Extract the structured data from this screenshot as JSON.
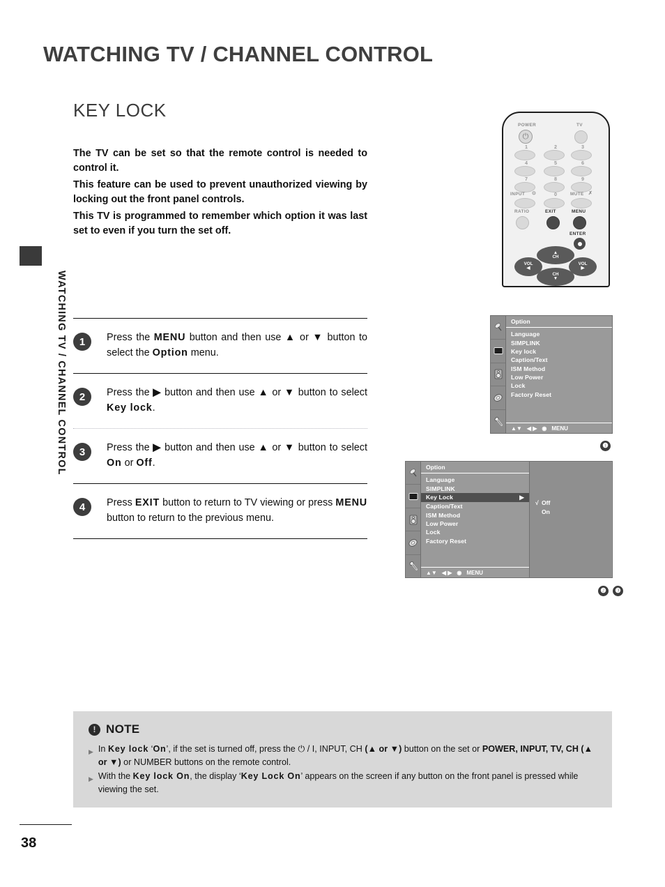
{
  "chapter": {
    "title": "WATCHING TV / CHANNEL CONTROL",
    "vertical_tab": "WATCHING TV / CHANNEL CONTROL"
  },
  "section": {
    "title": "KEY LOCK"
  },
  "intro": {
    "p1": "The TV can be set so that the remote control is needed to control it.",
    "p2": "This feature can be used to prevent unauthorized viewing by locking out the front panel controls.",
    "p3": "This TV is programmed to remember which option it was last set to even if you turn the set off."
  },
  "steps": [
    {
      "number": "1",
      "line1_a": "Press the ",
      "line1_b": "MENU",
      "line1_c": " button and then use ",
      "line1_d": "▲",
      "line1_e": " or ",
      "line1_f": "▼",
      "line1_g": " button to select the ",
      "line1_h": "Option",
      "line1_i": " menu."
    },
    {
      "number": "2",
      "line1_a": "Press the ",
      "line1_b": "▶",
      "line1_c": " button and then use ",
      "line1_d": "▲",
      "line1_e": " or ",
      "line1_f": "▼",
      "line1_g": " button to select ",
      "line1_h": "Key lock",
      "line1_i": "."
    },
    {
      "number": "3",
      "line1_a": "Press the ",
      "line1_b": "▶",
      "line1_c": " button and then use ",
      "line1_d": "▲",
      "line1_e": " or ",
      "line1_f": "▼",
      "line1_g": " button to select ",
      "line1_h": "On",
      "line1_i": " or ",
      "line1_j": "Off",
      "line1_k": "."
    },
    {
      "number": "4",
      "line1_a": "Press ",
      "line1_b": "EXIT",
      "line1_c": " button to return to TV viewing or press ",
      "line1_d": "MENU",
      "line1_e": " button to return to the previous menu."
    }
  ],
  "remote": {
    "power_label": "POWER",
    "tv_label": "TV",
    "power_glyph": "⏻",
    "numbers": [
      "1",
      "2",
      "3",
      "4",
      "5",
      "6",
      "7",
      "8",
      "9",
      "0"
    ],
    "input_label": "INPUT",
    "input_glyph": "⊙",
    "mute_label": "MUTE",
    "mute_glyph": "✗",
    "ratio_label": "RATIO",
    "exit_label": "EXIT",
    "menu_label": "MENU",
    "enter_label": "ENTER",
    "ch_up_label": "CH",
    "ch_down_label": "CH",
    "vol_left_label": "VOL",
    "vol_right_label": "VOL",
    "up_glyph": "▲",
    "down_glyph": "▼",
    "left_glyph": "◀",
    "right_glyph": "▶"
  },
  "osd1": {
    "header": "Option",
    "items": [
      "Language",
      "SIMPLINK",
      "Key lock",
      "Caption/Text",
      "ISM Method",
      "Low Power",
      "Lock",
      "Factory Reset"
    ],
    "footer": {
      "updown": "▲▼",
      "leftright": "◀ ▶",
      "enter": "◉",
      "menu": "MENU"
    },
    "marker": "❶"
  },
  "osd2": {
    "header": "Option",
    "items": [
      {
        "label": "Language",
        "selected": false,
        "arrow": ""
      },
      {
        "label": "SIMPLINK",
        "selected": false,
        "arrow": ""
      },
      {
        "label": "Key Lock",
        "selected": true,
        "arrow": "▶"
      },
      {
        "label": "Caption/Text",
        "selected": false,
        "arrow": ""
      },
      {
        "label": "ISM Method",
        "selected": false,
        "arrow": ""
      },
      {
        "label": "Low Power",
        "selected": false,
        "arrow": ""
      },
      {
        "label": "Lock",
        "selected": false,
        "arrow": ""
      },
      {
        "label": "Factory Reset",
        "selected": false,
        "arrow": ""
      }
    ],
    "submenu": [
      {
        "tick": "√",
        "label": "Off"
      },
      {
        "tick": "",
        "label": "On"
      }
    ],
    "footer": {
      "updown": "▲▼",
      "leftright": "◀ ▶",
      "enter": "◉",
      "menu": "MENU"
    },
    "marker_a": "❷",
    "marker_b": "❸"
  },
  "note": {
    "title": "NOTE",
    "icon_glyph": "!",
    "items": [
      {
        "a": "In ",
        "b": "Key lock",
        "c": " ‘",
        "d": "On",
        "e": "’, if the set is turned off, press the ",
        "f": "⏻ / I",
        "g": ", ",
        "h": "INPUT",
        "i": ", ",
        "j": "CH",
        "k": " (▲ or ▼)",
        "l": " button on the set or ",
        "m": "POWER, INPUT, TV, CH (▲ or ▼)",
        "n": " or NUMBER buttons on the remote control."
      },
      {
        "a": "With the ",
        "b": "Key lock On",
        "c": ", the display ‘",
        "d": "Key Lock On",
        "e": "’ appears on the screen if any button on the front panel is pressed while viewing the set."
      }
    ]
  },
  "footer": {
    "page_number": "38"
  },
  "colors": {
    "osd_background": "#9a9a9a",
    "osd_selected": "#4f4f4f",
    "note_background": "#d8d8d8",
    "heading": "#3f3f3f"
  }
}
